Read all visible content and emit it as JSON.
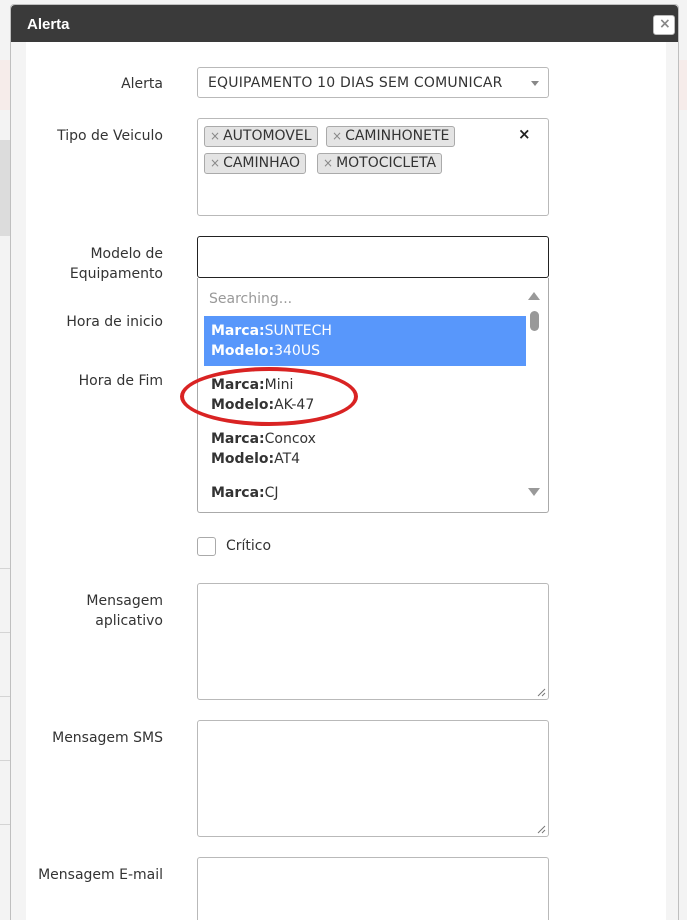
{
  "dialog": {
    "title": "Alerta"
  },
  "form": {
    "alerta_label": "Alerta",
    "alerta_value": "EQUIPAMENTO 10 DIAS SEM COMUNICAR",
    "tipo_label": "Tipo de Veiculo",
    "tipo_tags": [
      "AUTOMOVEL",
      "CAMINHONETE",
      "CAMINHAO",
      "MOTOCICLETA"
    ],
    "tag_remove_glyph": "×",
    "clear_glyph": "×",
    "modelo_label_line1": "Modelo de",
    "modelo_label_line2": "Equipamento",
    "hora_inicio_label": "Hora de inicio",
    "hora_fim_label": "Hora de Fim",
    "critico_label": "Crítico",
    "msg_app_line1": "Mensagem",
    "msg_app_line2": "aplicativo",
    "msg_sms_label": "Mensagem SMS",
    "msg_email_label": "Mensagem E-mail"
  },
  "dropdown": {
    "searching_text": "Searching...",
    "marca_prefix": "Marca:",
    "modelo_prefix": "Modelo:",
    "options": [
      {
        "marca": "SUNTECH",
        "modelo": "340US",
        "highlighted": true
      },
      {
        "marca": "Mini",
        "modelo": "AK-47",
        "highlighted": false
      },
      {
        "marca": "Concox",
        "modelo": "AT4",
        "highlighted": false
      },
      {
        "marca": "CJ",
        "modelo": "",
        "highlighted": false
      }
    ]
  },
  "colors": {
    "highlight": "#5897fb",
    "annotation": "#d92323",
    "titlebar": "#3a3a3a"
  },
  "icons": {
    "close": "close-icon",
    "dropdown_arrow": "chevron-down-icon"
  }
}
